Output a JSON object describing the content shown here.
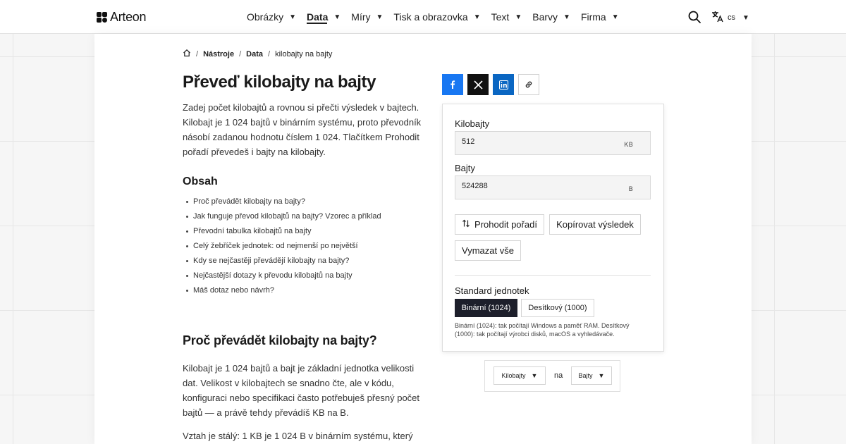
{
  "brand": {
    "name": "Arteon"
  },
  "nav": [
    {
      "label": "Obrázky",
      "active": false
    },
    {
      "label": "Data",
      "active": true
    },
    {
      "label": "Míry",
      "active": false
    },
    {
      "label": "Tisk a obrazovka",
      "active": false
    },
    {
      "label": "Text",
      "active": false
    },
    {
      "label": "Barvy",
      "active": false
    },
    {
      "label": "Firma",
      "active": false
    }
  ],
  "lang": {
    "code": "cs"
  },
  "breadcrumb": {
    "home_icon": "home-icon",
    "items": [
      "Nástroje",
      "Data",
      "kilobajty na bajty"
    ]
  },
  "title": "Převeď kilobajty na bajty",
  "intro": "Zadej počet kilobajtů a rovnou si přečti výsledek v bajtech. Kilobajt je 1 024 bajtů v binárním systému, proto převodník násobí zadanou hodnotu číslem 1 024. Tlačítkem Prohodit pořadí převedeš i bajty na kilobajty.",
  "toc": {
    "title": "Obsah",
    "items": [
      "Proč převádět kilobajty na bajty?",
      "Jak funguje převod kilobajtů na bajty? Vzorec a příklad",
      "Převodní tabulka kilobajtů na bajty",
      "Celý žebříček jednotek: od nejmenší po největší",
      "Kdy se nejčastěji převádějí kilobajty na bajty?",
      "Nejčastější dotazy k převodu kilobajtů na bajty",
      "Máš dotaz nebo návrh?"
    ]
  },
  "section": {
    "heading": "Proč převádět kilobajty na bajty?",
    "p1": "Kilobajt je 1 024 bajtů a bajt je základní jednotka velikosti dat. Velikost v kilobajtech se snadno čte, ale v kódu, konfiguraci nebo specifikaci často potřebuješ přesný počet bajtů — a právě tehdy převádíš KB na B.",
    "p2": "Vztah je stálý: 1 KB je 1 024 B v binárním systému, který"
  },
  "share": [
    "facebook-icon",
    "x-icon",
    "linkedin-icon",
    "link-icon"
  ],
  "converter": {
    "from_label": "Kilobajty",
    "from_value": "512",
    "from_unit": "KB",
    "to_label": "Bajty",
    "to_value": "524288",
    "to_unit": "B",
    "swap_label": "Prohodit pořadí",
    "copy_label": "Kopírovat výsledek",
    "clear_label": "Vymazat vše",
    "standard_label": "Standard jednotek",
    "binary_label": "Binární (1024)",
    "decimal_label": "Desítkový (1000)",
    "selected_standard": "Binární (1024)",
    "note": "Binární (1024): tak počítají Windows a paměť RAM. Desítkový (1000): tak počítají výrobci disků, macOS a vyhledávače."
  },
  "unit_pair": {
    "from": "Kilobajty",
    "connector": "na",
    "to": "Bajty"
  },
  "colors": {
    "facebook": "#1877f2",
    "x": "#111111",
    "linkedin": "#0a66c2",
    "selected": "#1d1f2b"
  }
}
